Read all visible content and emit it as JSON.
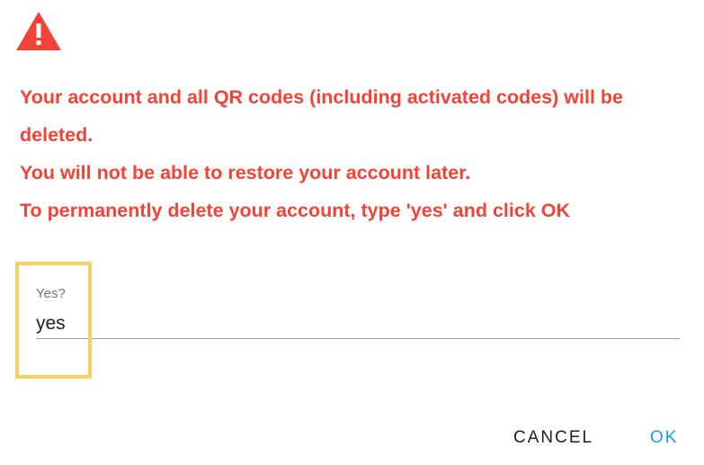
{
  "dialog": {
    "icon": "warning-triangle-icon",
    "colors": {
      "warning": "#f44336",
      "accent": "#2196f3",
      "highlight": "#f9cf62"
    },
    "message_lines": [
      "Your account and all QR codes (including activated codes) will be",
      "deleted.",
      "You will not be able to restore your account later.",
      "To permanently delete your account, type 'yes' and click OK"
    ],
    "input": {
      "label": "Yes?",
      "value": "yes"
    },
    "actions": {
      "cancel_label": "CANCEL",
      "ok_label": "OK"
    }
  }
}
